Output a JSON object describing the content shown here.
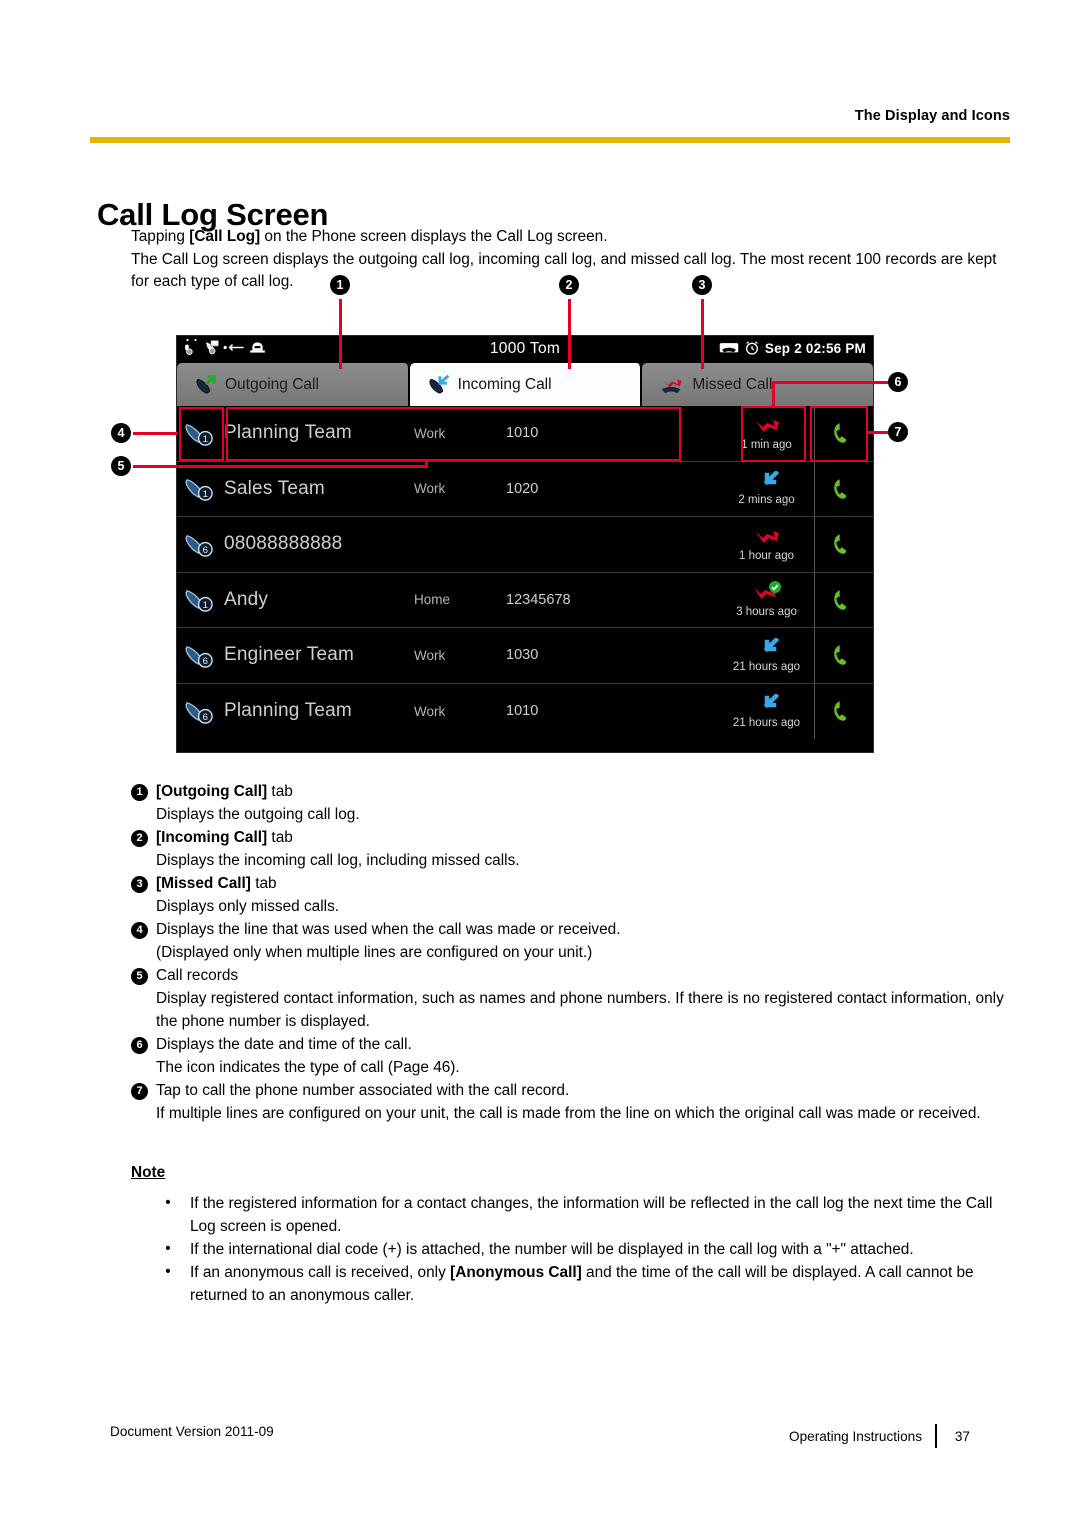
{
  "header": {
    "running_head": "The Display and Icons",
    "rule_color": "#e3b505"
  },
  "title": "Call Log Screen",
  "intro": {
    "line1_pre": "Tapping ",
    "line1_bold": "[Call Log]",
    "line1_post": " on the Phone screen displays the Call Log screen.",
    "line2": "The Call Log screen displays the outgoing call log, incoming call log, and missed call log. The most recent 100 records are kept for each type of call log."
  },
  "screenshot": {
    "statusbar": {
      "title": "1000  Tom",
      "datetime": "Sep 2 02:56 PM",
      "left_icons": [
        "headset-icon",
        "voice-message-icon",
        "call-forward-arrow-icon",
        "handset-device-icon"
      ],
      "right_icons": [
        "missed-call-icon",
        "alarm-clock-icon"
      ]
    },
    "tabs": [
      {
        "label": "Outgoing Call",
        "icon": "outgoing-call-icon",
        "selected": false
      },
      {
        "label": "Incoming Call",
        "icon": "incoming-call-icon",
        "selected": true
      },
      {
        "label": "Missed Call",
        "icon": "missed-call-icon",
        "selected": false
      }
    ],
    "rows": [
      {
        "line": "1",
        "name": "Planning Team",
        "type": "Work",
        "number": "1010",
        "when": "1 min ago",
        "status_icon": "missed-call-icon"
      },
      {
        "line": "1",
        "name": "Sales Team",
        "type": "Work",
        "number": "1020",
        "when": "2 mins ago",
        "status_icon": "incoming-call-icon"
      },
      {
        "line": "6",
        "name": "08088888888",
        "type": "",
        "number": "",
        "when": "1 hour ago",
        "status_icon": "missed-call-icon"
      },
      {
        "line": "1",
        "name": "Andy",
        "type": "Home",
        "number": "12345678",
        "when": "3 hours ago",
        "status_icon": "missed-call-checked-icon"
      },
      {
        "line": "6",
        "name": "Engineer Team",
        "type": "Work",
        "number": "1030",
        "when": "21 hours ago",
        "status_icon": "incoming-call-icon"
      },
      {
        "line": "6",
        "name": "Planning Team",
        "type": "Work",
        "number": "1010",
        "when": "21 hours ago",
        "status_icon": "incoming-call-icon"
      }
    ],
    "callouts": [
      "1",
      "2",
      "3",
      "4",
      "5",
      "6",
      "7"
    ],
    "annotation_color": "#e4002b"
  },
  "descriptions": [
    {
      "n": "1",
      "bold": "[Outgoing Call]",
      "rest": " tab",
      "sub": "Displays the outgoing call log."
    },
    {
      "n": "2",
      "bold": "[Incoming Call]",
      "rest": " tab",
      "sub": "Displays the incoming call log, including missed calls."
    },
    {
      "n": "3",
      "bold": "[Missed Call]",
      "rest": " tab",
      "sub": "Displays only missed calls."
    },
    {
      "n": "4",
      "bold": "",
      "rest": "Displays the line that was used when the call was made or received.",
      "sub": "(Displayed only when multiple lines are configured on your unit.)"
    },
    {
      "n": "5",
      "bold": "",
      "rest": "Call records",
      "sub": "Display registered contact information, such as names and phone numbers. If there is no registered contact information, only the phone number is displayed."
    },
    {
      "n": "6",
      "bold": "",
      "rest": "Displays the date and time of the call.",
      "sub": "The icon indicates the type of call (Page 46)."
    },
    {
      "n": "7",
      "bold": "",
      "rest": "Tap to call the phone number associated with the call record.",
      "sub": "If multiple lines are configured on your unit, the call is made from the line on which the original call was made or received."
    }
  ],
  "note": {
    "heading": "Note",
    "bullet_glyph": "•",
    "items": [
      {
        "pre": "If the registered information for a contact changes, the information will be reflected in the call log the next time the Call Log screen is opened.",
        "bold": "",
        "post": ""
      },
      {
        "pre": "If the international dial code (+) is attached, the number will be displayed in the call log with a \"+\" attached.",
        "bold": "",
        "post": ""
      },
      {
        "pre": "If an anonymous call is received, only ",
        "bold": "[Anonymous Call]",
        "post": " and the time of the call will be displayed. A call cannot be returned to an anonymous caller."
      }
    ]
  },
  "footer": {
    "left": "Document Version  2011-09",
    "right": "Operating Instructions",
    "page": "37"
  }
}
